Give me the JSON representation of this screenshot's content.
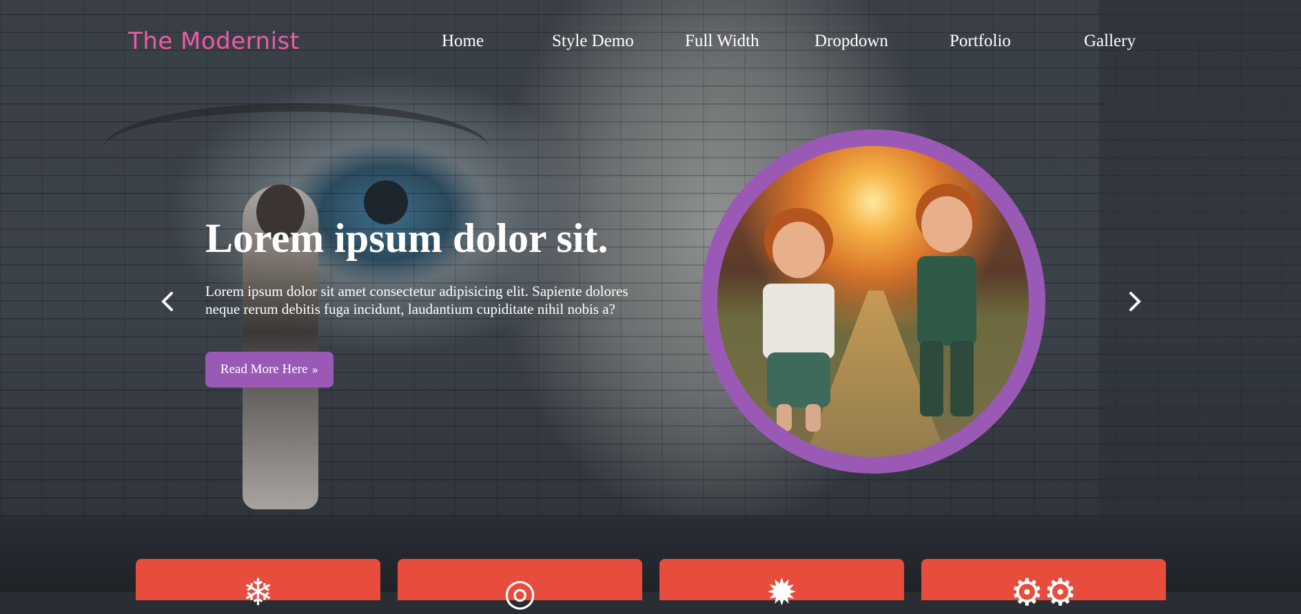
{
  "site": {
    "logo": "The Modernist"
  },
  "nav": {
    "items": [
      {
        "label": "Home"
      },
      {
        "label": "Style Demo"
      },
      {
        "label": "Full Width"
      },
      {
        "label": "Dropdown"
      },
      {
        "label": "Portfolio"
      },
      {
        "label": "Gallery"
      }
    ]
  },
  "slider": {
    "prev_icon": "chevron-left-icon",
    "next_icon": "chevron-right-icon",
    "title": "Lorem ipsum dolor sit.",
    "description": "Lorem ipsum dolor sit amet consectetur adipisicing elit. Sapiente dolores neque rerum debitis fuga incidunt, laudantium cupiditate nihil nobis a?",
    "button_label": "Read More Here",
    "button_icon": "double-chevron-right-icon"
  },
  "features": {
    "cards": [
      {
        "icon": "snowflake-icon"
      },
      {
        "icon": "target-icon"
      },
      {
        "icon": "sun-icon"
      },
      {
        "icon": "gears-icon"
      }
    ]
  },
  "colors": {
    "logo": "#ef5aa7",
    "accent_purple": "#9b59b6",
    "card_red": "#e74c3c"
  }
}
